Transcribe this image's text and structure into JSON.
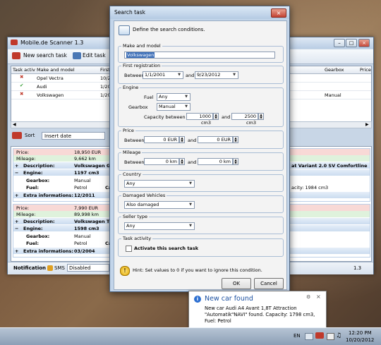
{
  "main_window": {
    "title": "Mobile.de Scanner 1.3",
    "toolbar": {
      "new_search_task": "New search task",
      "edit_task": "Edit task"
    },
    "grid": {
      "columns": [
        "Task activ",
        "Make and model",
        "First r",
        "Gearbox",
        "Price"
      ],
      "rows": [
        {
          "status": "inactive",
          "model": "Opel Vectra",
          "first_reg": "10/20",
          "gearbox": ""
        },
        {
          "status": "active",
          "model": "Audi",
          "first_reg": "1/200",
          "gearbox": ""
        },
        {
          "status": "inactive",
          "model": "Volkswagen",
          "first_reg": "1/200",
          "gearbox": "Manual"
        }
      ]
    },
    "sort": {
      "label": "Sort",
      "value": "Insert date"
    },
    "results": [
      {
        "price_label": "Price:",
        "price": "18,950 EUR",
        "mileage_label": "Mileage:",
        "mileage": "9,662 km",
        "description_label": "Description:",
        "description_value": "Volkswagen Go",
        "description_right": "at Variant 2.0 SV Comfortline",
        "engine_label": "Engine:",
        "engine_value": "1197 cm3",
        "gearbox_label": "Gearbox:",
        "gearbox_value": "Manual",
        "fuel_label": "Fuel:",
        "fuel_value": "Petrol",
        "fuel_tail": "Ca",
        "capacity_right": "acity: 1984 cm3",
        "extra_label": "Extra informations:",
        "extra_value": "12/2011"
      },
      {
        "price_label": "Price:",
        "price": "7,990 EUR",
        "mileage_label": "Mileage:",
        "mileage": "89,998 km",
        "description_label": "Description:",
        "description_value": "Volkswagen To",
        "engine_label": "Engine:",
        "engine_value": "1598 cm3",
        "gearbox_label": "Gearbox:",
        "gearbox_value": "Manual",
        "fuel_label": "Fuel:",
        "fuel_value": "Petrol",
        "fuel_tail": "Ca",
        "extra_label": "Extra informations:",
        "extra_value": "03/2004"
      }
    ],
    "status": {
      "notification_label": "Notification",
      "sms_label": "SMS",
      "sms_value": "Disabled",
      "version": "1.3"
    }
  },
  "dialog": {
    "title": "Search task",
    "header_text": "Define the search conditions.",
    "make_model": {
      "label": "Make and model",
      "value": "Volkswagen"
    },
    "first_registration": {
      "label": "First registration",
      "between": "Between",
      "from": "1/1/2001",
      "and": "and",
      "to": "9/23/2012"
    },
    "engine": {
      "label": "Engine",
      "fuel_label": "Fuel",
      "fuel_value": "Any",
      "gearbox_label": "Gearbox",
      "gearbox_value": "Manual",
      "capacity_label": "Capacity between",
      "capacity_from": "1000 cm3",
      "and": "and",
      "capacity_to": "2500 cm3"
    },
    "price": {
      "label": "Price",
      "between": "Between",
      "from": "0 EUR",
      "and": "and",
      "to": "0 EUR"
    },
    "mileage": {
      "label": "Mileage",
      "between": "Between",
      "from": "0 km",
      "and": "and",
      "to": "0 km"
    },
    "country": {
      "label": "Country",
      "value": "Any"
    },
    "damaged": {
      "label": "Damaged Vehicles",
      "value": "Also damaged"
    },
    "seller": {
      "label": "Seller type",
      "value": "Any"
    },
    "activity": {
      "label": "Task activity",
      "checkbox_label": "Activate this search task",
      "checked": false
    },
    "hint": "Hint: Set values to 0 if you want to ignore this condition.",
    "ok": "OK",
    "cancel": "Cancel"
  },
  "notification": {
    "title": "New car found",
    "text": "New car Audi A4 Avant 1,8T Attraction \"Automatik\"NAVI\" found. Capacity: 1798 cm3, Fuel: Petrol"
  },
  "taskbar": {
    "lang": "EN",
    "time": "12:20 PM",
    "date": "10/20/2012"
  }
}
